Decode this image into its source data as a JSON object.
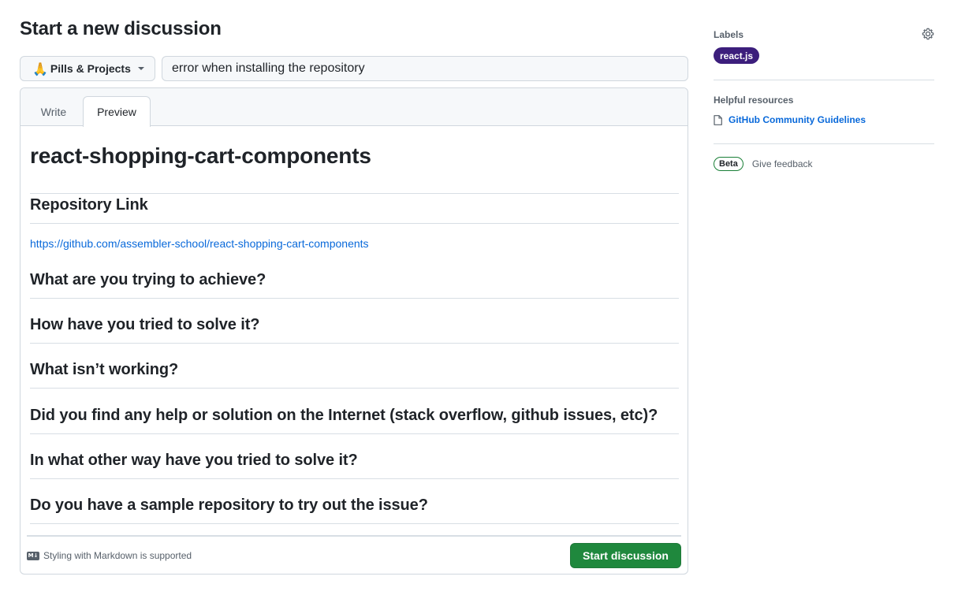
{
  "page": {
    "title": "Start a new discussion"
  },
  "category": {
    "emoji": "🙏",
    "label": "Pills & Projects"
  },
  "discussion_title": {
    "value": "error when installing the repository"
  },
  "editor": {
    "tabs": [
      {
        "label": "Write"
      },
      {
        "label": "Preview"
      }
    ],
    "active_tab": "Preview",
    "preview": {
      "h1": "react-shopping-cart-components",
      "sections": [
        "Repository Link",
        "What are you trying to achieve?",
        "How have you tried to solve it?",
        "What isn’t working?",
        "Did you find any help or solution on the Internet (stack overflow, github issues, etc)?",
        "In what other way have you tried to solve it?",
        "Do you have a sample repository to try out the issue?"
      ],
      "repo_link": "https://github.com/assembler-school/react-shopping-cart-components"
    },
    "footer": {
      "markdown_note": "Styling with Markdown is supported",
      "submit_label": "Start discussion"
    }
  },
  "sidebar": {
    "labels_heading": "Labels",
    "labels": [
      {
        "name": "react.js",
        "color": "#3c1e7c"
      }
    ],
    "resources_heading": "Helpful resources",
    "resources": [
      {
        "label": "GitHub Community Guidelines"
      }
    ],
    "beta_badge": "Beta",
    "feedback_label": "Give feedback"
  },
  "colors": {
    "primary_button": "#1f883d",
    "link": "#0969da",
    "label_bg": "#3c1e7c"
  }
}
